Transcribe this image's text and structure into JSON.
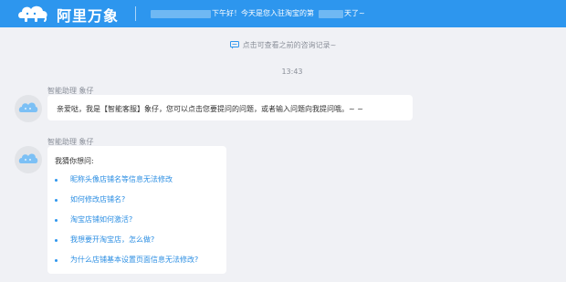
{
  "header": {
    "brand": "阿里万象",
    "greeting_part1": "下午好！今天是您入驻淘宝的第",
    "greeting_part2": "天了~",
    "bg_color": "#2d96ee"
  },
  "history_link": {
    "icon": "chat-bubble-icon",
    "label": "点击可查看之前的咨询记录~"
  },
  "timestamp": "13:43",
  "messages": [
    {
      "sender": "智能助理  象仔",
      "avatar_icon": "elephant-cloud-avatar",
      "text": "亲爱哒，我是【智能客服】象仔，您可以点击您要提问的问题，或者输入问题向我提问哦。~ ~"
    },
    {
      "sender": "智能助理  象仔",
      "avatar_icon": "elephant-cloud-avatar",
      "title": "我猜你想问:",
      "questions": [
        "昵称头像店铺名等信息无法修改",
        "如何修改店铺名?",
        "淘宝店铺如何激活?",
        "我想要开淘宝店，怎么做?",
        "为什么店铺基本设置页面信息无法修改?"
      ]
    }
  ]
}
